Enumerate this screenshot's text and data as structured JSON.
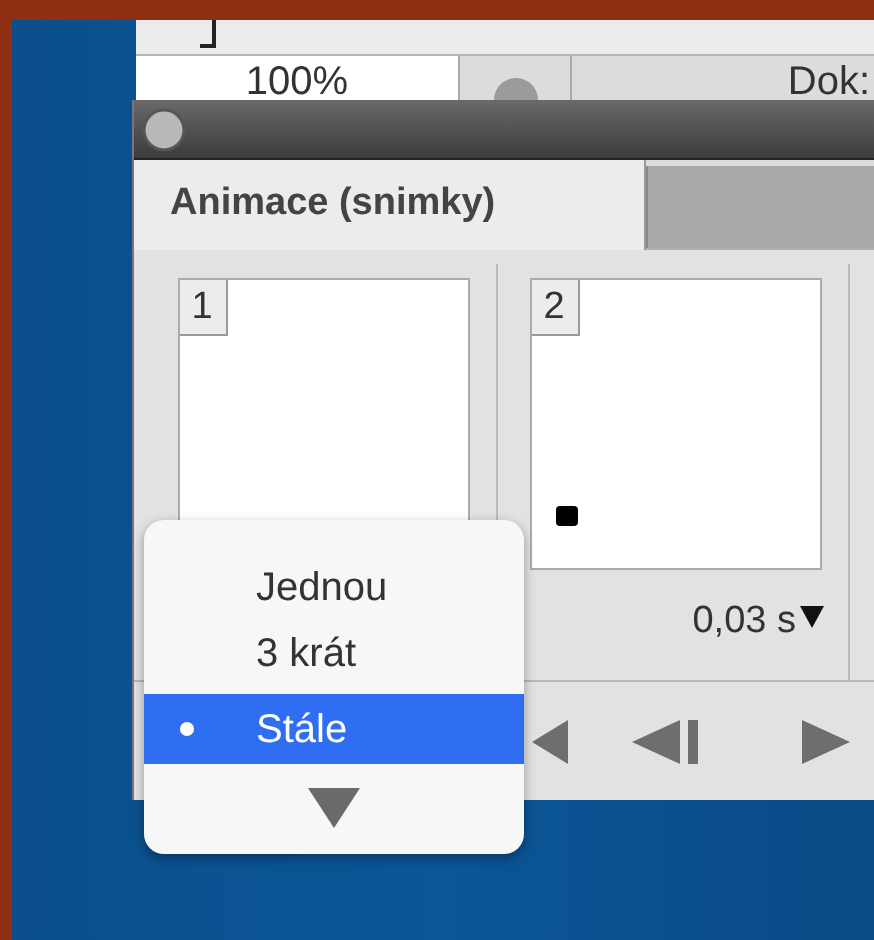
{
  "background_window": {
    "zoom_field": "100%",
    "document_label": "Dok:"
  },
  "panel": {
    "tabs": [
      {
        "label": "Animace (snimky)",
        "selected": true
      }
    ],
    "frames": [
      {
        "number": "1"
      },
      {
        "number": "2",
        "delay": "0,03 s"
      }
    ]
  },
  "loop_menu": {
    "items": [
      {
        "label": "Jednou",
        "selected": false
      },
      {
        "label": "3 krát",
        "selected": false
      },
      {
        "label": "Stále",
        "selected": true
      }
    ]
  }
}
